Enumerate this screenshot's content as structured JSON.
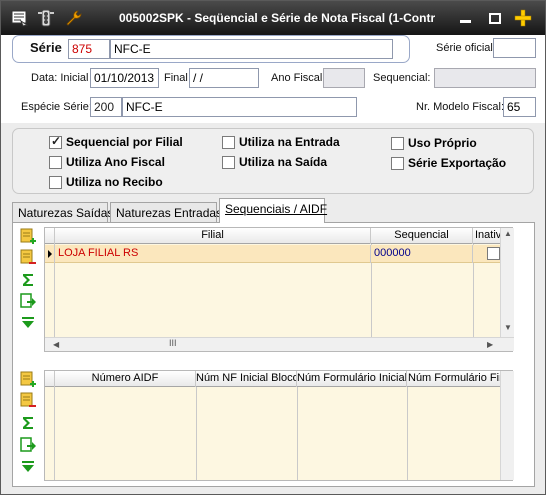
{
  "window": {
    "title": "005002SPK - Seqüencial e Série de Nota Fiscal (1-Contr",
    "icons": [
      "menu-icon",
      "traffic-light-icon",
      "wrench-icon"
    ],
    "controls": [
      "minimize-icon",
      "restore-icon",
      "add-icon"
    ]
  },
  "header": {
    "serie_label": "Série",
    "serie_code": "875",
    "serie_desc": "NFC-E",
    "serie_oficial_label": "Série oficial",
    "serie_oficial_value": "",
    "data_label": "Data: Inicial",
    "data_inicial": "01/10/2013",
    "final_label": "Final",
    "data_final": " /  /",
    "ano_fiscal_label": "Ano Fiscal:",
    "ano_fiscal_value": "",
    "sequencial_label": "Sequencial:",
    "sequencial_value": "",
    "especie_label": "Espécie Série:",
    "especie_code": "200",
    "especie_desc": "NFC-E",
    "modelo_label": "Nr. Modelo Fiscal:",
    "modelo_value": "65"
  },
  "options": [
    {
      "label": "Sequencial por Filial",
      "checked": true
    },
    {
      "label": "Utiliza Ano Fiscal",
      "checked": false
    },
    {
      "label": "Utiliza no Recibo",
      "checked": false
    },
    {
      "label": "Utiliza na Entrada",
      "checked": false
    },
    {
      "label": "Utiliza na Saída",
      "checked": false
    },
    {
      "label": "Uso Próprio",
      "checked": false
    },
    {
      "label": "Série Exportação",
      "checked": false
    }
  ],
  "tabs": [
    {
      "label": "Naturezas Saídas",
      "active": false
    },
    {
      "label": "Naturezas Entradas",
      "active": false
    },
    {
      "label": "Sequenciais / AIDF",
      "active": true
    }
  ],
  "grid1": {
    "columns": [
      "Filial",
      "Sequencial",
      "Inativa"
    ],
    "rows": [
      {
        "filial": "LOJA FILIAL RS",
        "sequencial": "000000",
        "inativa": false
      }
    ],
    "scroll_glyph": "III",
    "tools": [
      "add-record-icon",
      "remove-record-icon",
      "sum-icon",
      "export-icon",
      "expand-down-icon"
    ]
  },
  "grid2": {
    "columns": [
      "Número AIDF",
      "Núm NF Inicial Bloco",
      "Núm Formulário Inicial",
      "Núm Formulário Final"
    ],
    "rows": [],
    "tools": [
      "add-record-icon",
      "remove-record-icon",
      "sum-icon",
      "export-icon",
      "expand-down-icon"
    ]
  },
  "colors": {
    "titlebar": "#1f1f1f",
    "row_highlight": "#fbe7bd",
    "grid_bg": "#fdf7e1",
    "serie_code": "#cc0000",
    "filial_text": "#cc0000",
    "sequencial_text": "#00008b"
  }
}
